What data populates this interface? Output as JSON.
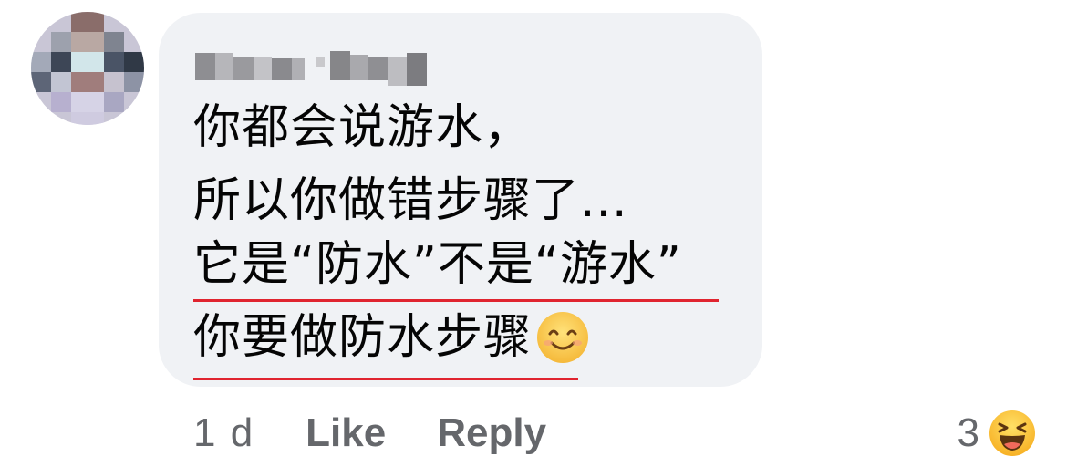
{
  "comment": {
    "author_name": "████ ████",
    "lines": [
      "你都会说游水，",
      "所以你做错步骤了...",
      "它是“防水”不是“游水”",
      "你要做防水步骤"
    ],
    "emoji": "smiling-face-icon"
  },
  "actions": {
    "timestamp": "1 d",
    "like_label": "Like",
    "reply_label": "Reply"
  },
  "reactions": {
    "count": "3",
    "type": "haha-icon"
  },
  "colors": {
    "bubble": "#f0f2f5",
    "text": "#050505",
    "meta": "#65676b",
    "underline": "#e0242f"
  }
}
